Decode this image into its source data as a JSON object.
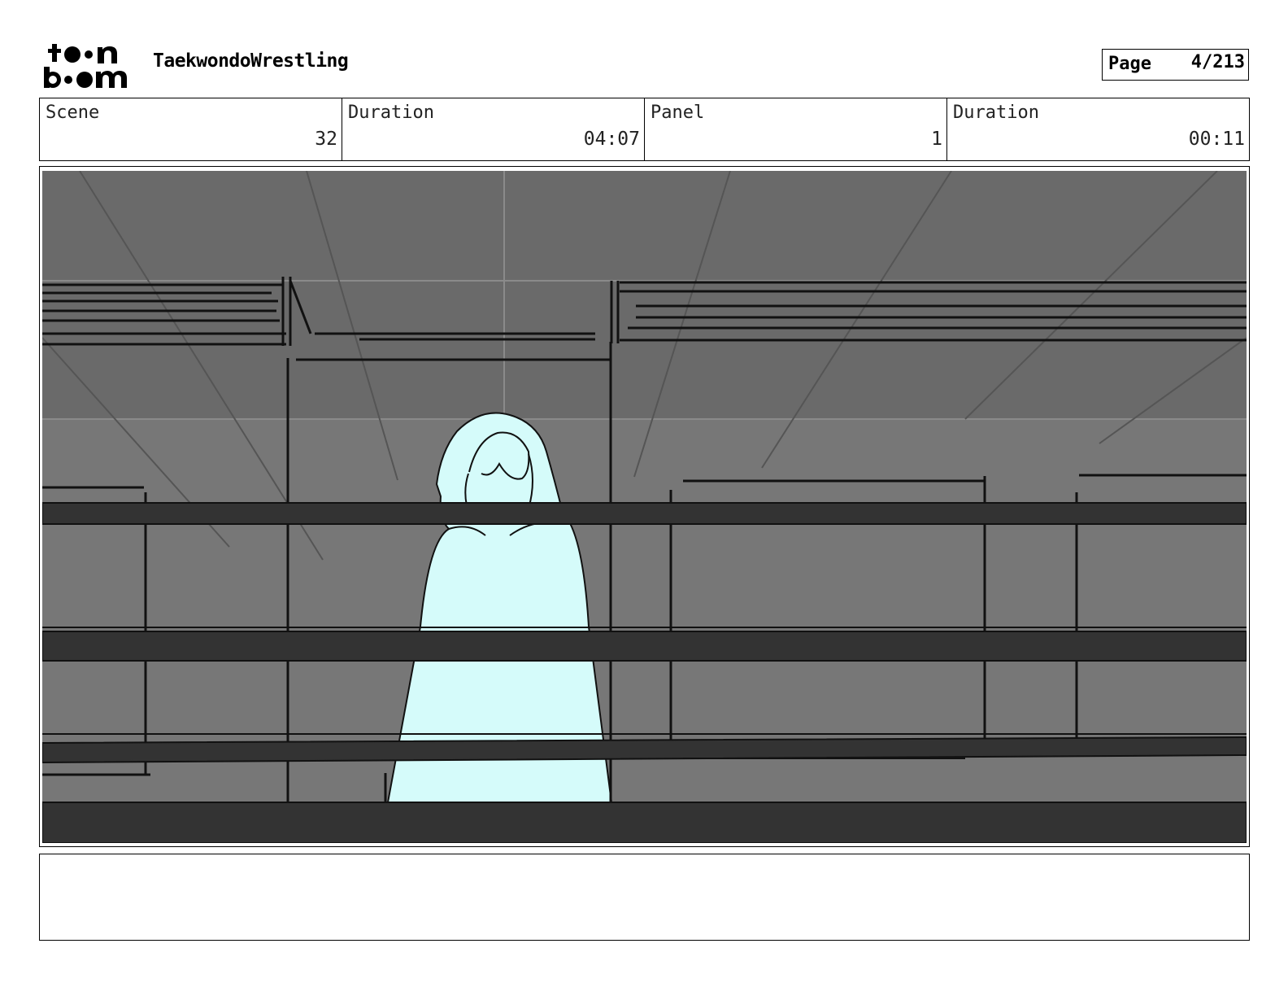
{
  "header": {
    "logo_text": "toon boom",
    "project_title": "TaekwondoWrestling",
    "page_label": "Page",
    "page_value": "4/213"
  },
  "info": [
    {
      "label": "Scene",
      "value": "32"
    },
    {
      "label": "Duration",
      "value": "04:07"
    },
    {
      "label": "Panel",
      "value": "1"
    },
    {
      "label": "Duration",
      "value": "00:11"
    }
  ],
  "panel": {
    "colors": {
      "background": "#767676",
      "ceiling": "#686868",
      "railings": "#333333",
      "figure": "#d5fbfa",
      "line": "#111111"
    }
  },
  "notes": {
    "text": ""
  }
}
